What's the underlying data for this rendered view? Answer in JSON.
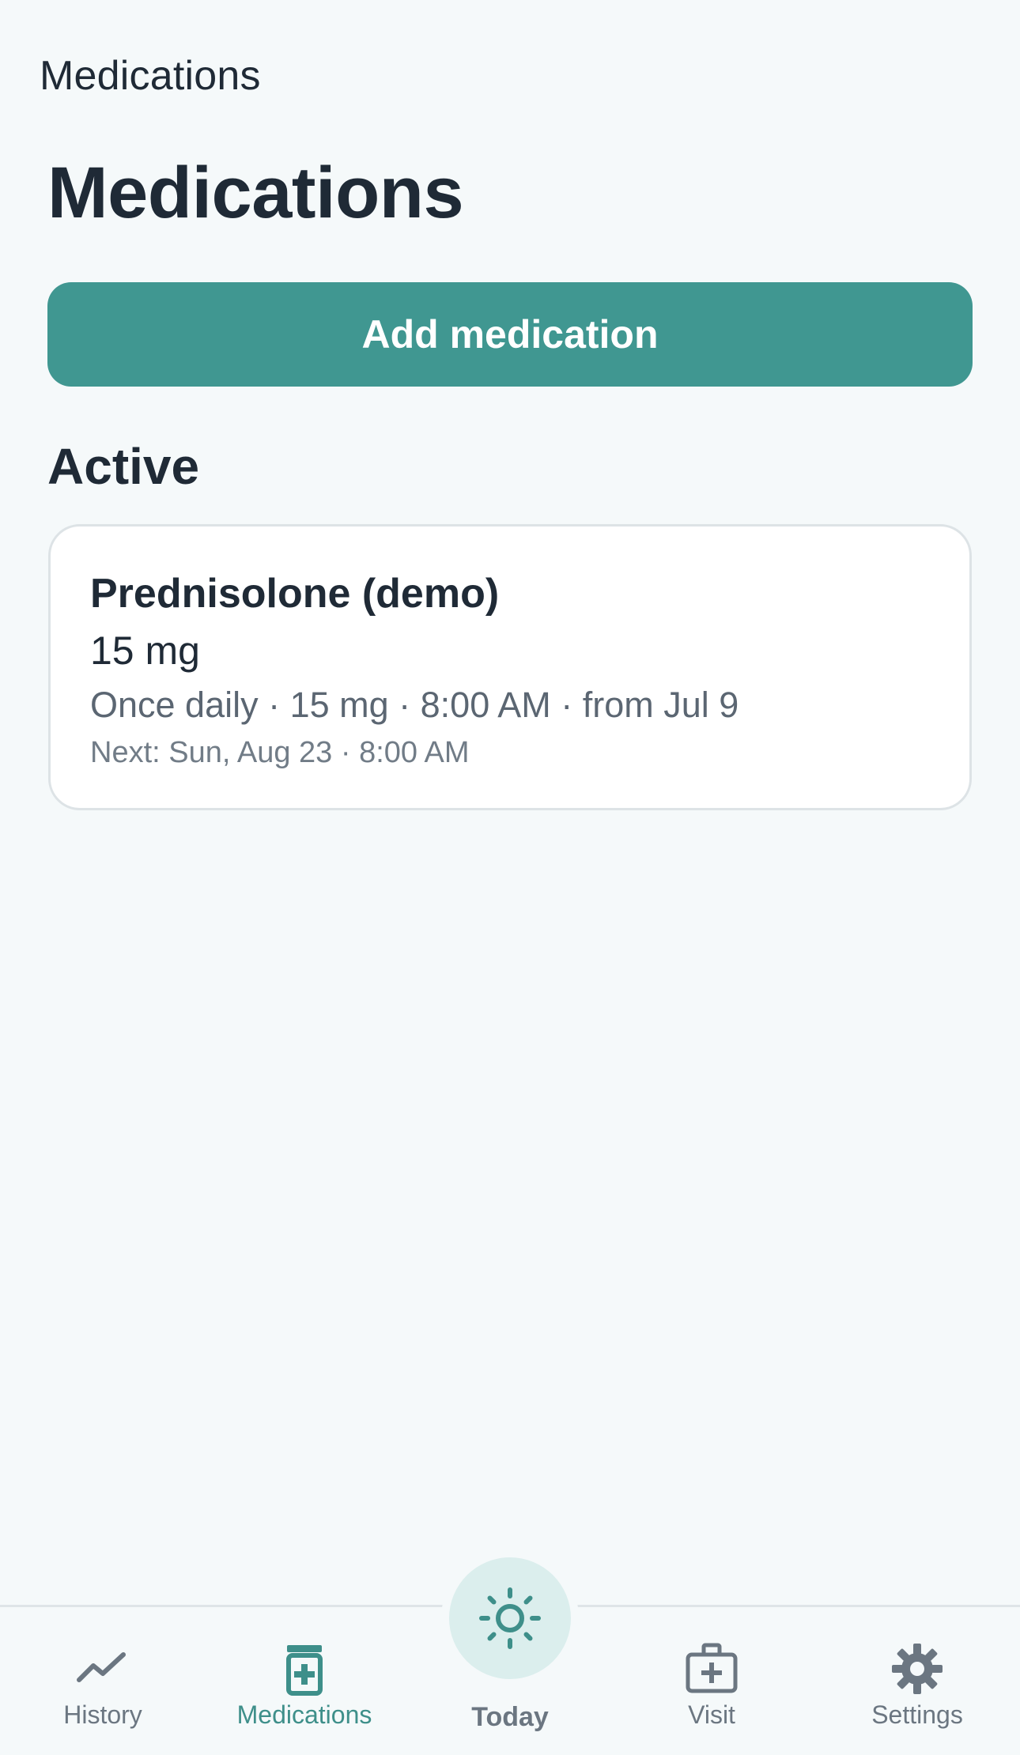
{
  "header": {
    "nav_title": "Medications",
    "page_title": "Medications"
  },
  "actions": {
    "add_medication_label": "Add medication"
  },
  "sections": {
    "active_title": "Active"
  },
  "medications": [
    {
      "name": "Prednisolone (demo)",
      "dose": "15 mg",
      "schedule": "Once daily · 15 mg · 8:00 AM · from Jul 9",
      "next": "Next: Sun, Aug 23 · 8:00 AM"
    }
  ],
  "tab_bar": {
    "history": {
      "label": "History",
      "icon": "trend-line-icon"
    },
    "medications": {
      "label": "Medications",
      "icon": "pill-bottle-icon"
    },
    "today": {
      "label": "Today",
      "icon": "sun-icon"
    },
    "visit": {
      "label": "Visit",
      "icon": "medical-kit-icon"
    },
    "settings": {
      "label": "Settings",
      "icon": "gear-icon"
    },
    "active_tab": "Medications"
  },
  "colors": {
    "accent": "#409791",
    "background": "#f5f9fa",
    "text_primary": "#1f2a36",
    "text_secondary": "#5b6672",
    "tab_inactive": "#6b7681",
    "today_circle": "#dbeeed"
  }
}
